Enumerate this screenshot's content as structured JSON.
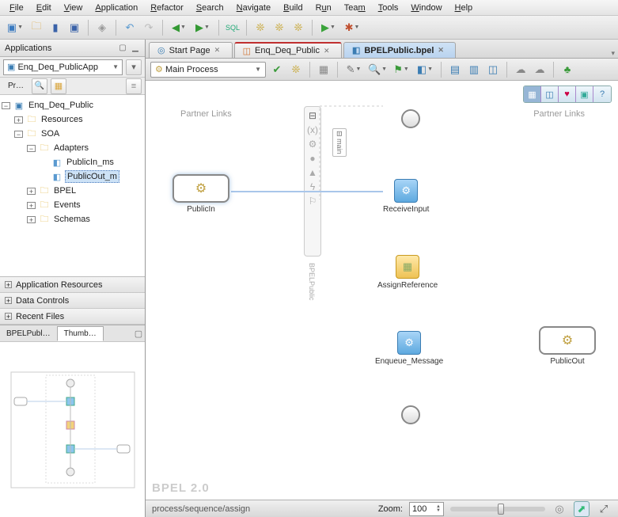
{
  "menu": {
    "file": "File",
    "edit": "Edit",
    "view": "View",
    "application": "Application",
    "refactor": "Refactor",
    "search": "Search",
    "navigate": "Navigate",
    "build": "Build",
    "run": "Run",
    "team": "Team",
    "tools": "Tools",
    "window": "Window",
    "help": "Help"
  },
  "left_panel": {
    "title": "Applications",
    "app_selector": "Enq_Deq_PublicApp",
    "tab_label": "Pr…",
    "tree": {
      "root": "Enq_Deq_Public",
      "resources": "Resources",
      "soa": "SOA",
      "adapters": "Adapters",
      "publicin": "PublicIn_ms",
      "publicout": "PublicOut_m",
      "bpel": "BPEL",
      "events": "Events",
      "schemas": "Schemas"
    },
    "accordion": {
      "app_res": "Application Resources",
      "data_ctl": "Data Controls",
      "recent": "Recent Files"
    },
    "tabs": {
      "bpel": "BPELPubl…",
      "thumb": "Thumb…"
    }
  },
  "editor_tabs": {
    "start": "Start Page",
    "enqdeq": "Enq_Deq_Public",
    "bpelpub": "BPELPublic.bpel"
  },
  "subtoolbar": {
    "process": "Main Process"
  },
  "canvas": {
    "pl_left_label": "Partner Links",
    "pl_right_label": "Partner Links",
    "publicIn": "PublicIn",
    "publicOut": "PublicOut",
    "receive": "ReceiveInput",
    "assign": "AssignReference",
    "enqueue": "Enqueue_Message",
    "main_label": "main",
    "vertical_text": "BPELPublic",
    "watermark": "BPEL 2.0"
  },
  "status": {
    "breadcrumb": "process/sequence/assign",
    "zoom_label": "Zoom:",
    "zoom_value": "100"
  },
  "icons": {
    "gear": "⚙",
    "arrow_r": "→",
    "arrow_d": "▼",
    "close": "✕",
    "plus": "+",
    "minus": "−",
    "search": "🔍",
    "refresh": "⟳",
    "check": "✔",
    "play": "▶",
    "bug": "🐞",
    "save": "💾",
    "open": "📂",
    "new": "📄",
    "undo": "↶",
    "redo": "↷",
    "back": "⬅",
    "fwd": "➡"
  }
}
